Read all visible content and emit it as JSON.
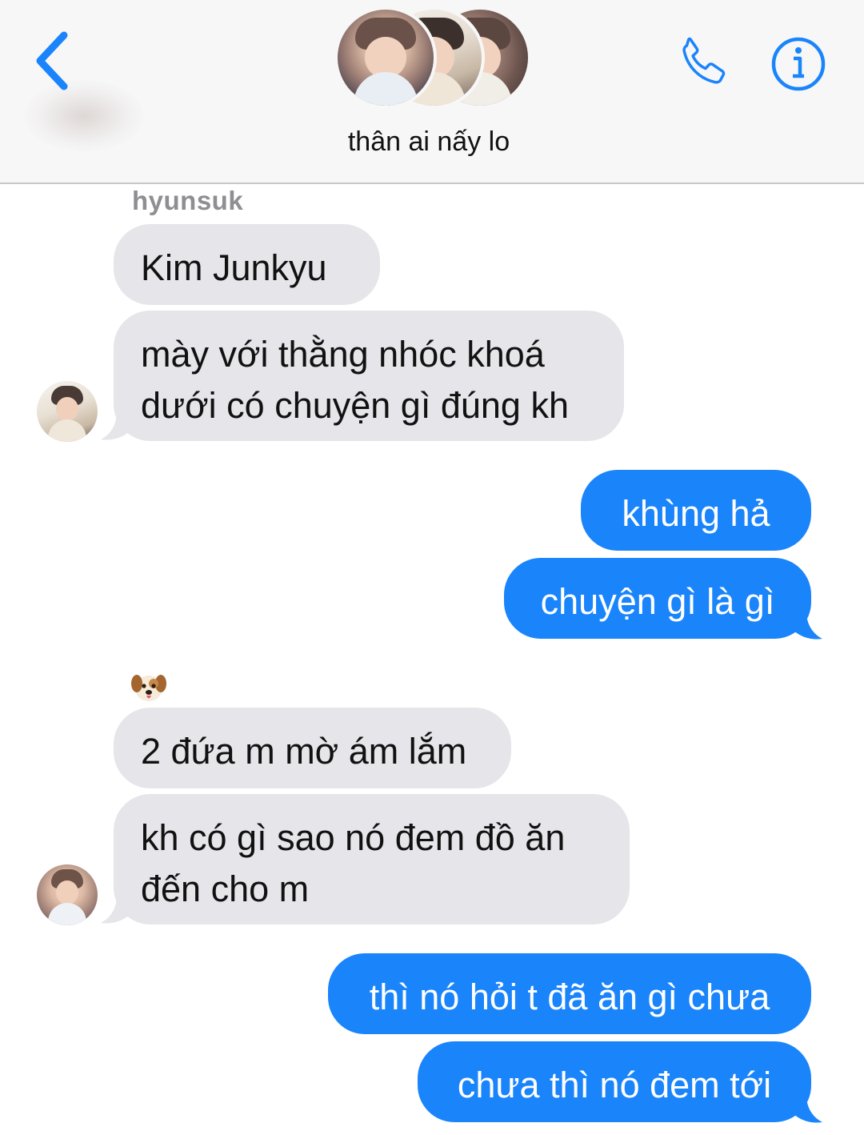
{
  "header": {
    "group_name": "thân ai nấy lo",
    "accent_color": "#1a84fb"
  },
  "messages": [
    {
      "id": "m1",
      "sender": "hyunsuk",
      "direction": "incoming",
      "lines": [
        "Kim Junkyu"
      ]
    },
    {
      "id": "m2",
      "sender": "hyunsuk",
      "direction": "incoming",
      "lines": [
        "mày với thằng nhóc khoá",
        "dưới có chuyện gì đúng kh"
      ]
    },
    {
      "id": "m3",
      "sender": "me",
      "direction": "outgoing",
      "lines": [
        "khùng hả"
      ]
    },
    {
      "id": "m4",
      "sender": "me",
      "direction": "outgoing",
      "lines": [
        "chuyện gì là gì"
      ]
    },
    {
      "id": "m5",
      "sender": "dog-emoji",
      "direction": "incoming",
      "lines": [
        "2 đứa m mờ ám lắm"
      ]
    },
    {
      "id": "m6",
      "sender": "dog-emoji",
      "direction": "incoming",
      "lines": [
        "kh có gì sao nó đem đồ ăn",
        "đến cho m"
      ]
    },
    {
      "id": "m7",
      "sender": "me",
      "direction": "outgoing",
      "lines": [
        "thì nó hỏi t đã ăn gì chưa"
      ]
    },
    {
      "id": "m8",
      "sender": "me",
      "direction": "outgoing",
      "lines": [
        "chưa thì nó đem tới"
      ]
    }
  ],
  "sender_labels": {
    "first": "hyunsuk",
    "second_icon": "dog-face-emoji"
  },
  "colors": {
    "incoming_bubble": "#e5e5ea",
    "outgoing_bubble": "#1a84fb",
    "sender_name": "#8e8e93"
  },
  "icons": {
    "back": "chevron-left-icon",
    "call": "phone-icon",
    "info": "info-icon"
  }
}
